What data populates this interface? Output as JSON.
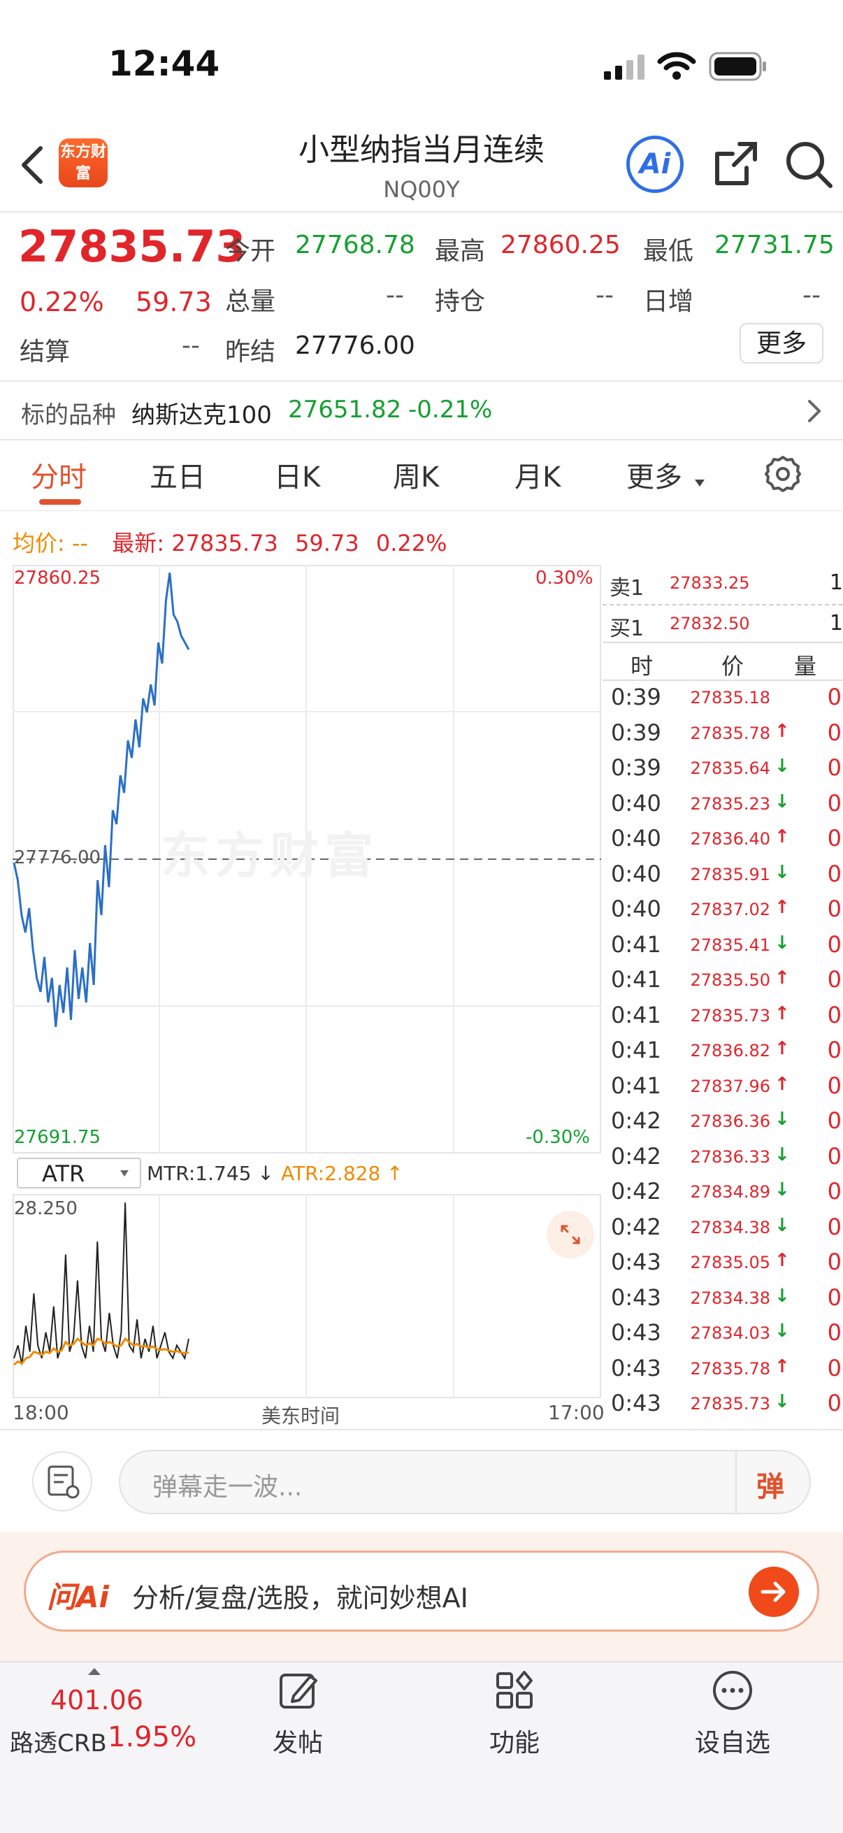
{
  "status_bar": {
    "time": "12:44"
  },
  "header": {
    "title": "小型纳指当月连续",
    "code": "NQ00Y",
    "logo_text": "东方财富",
    "ai_label": "Ai"
  },
  "quote": {
    "price": "27835.73",
    "change_pct": "0.22%",
    "change": "59.73",
    "open_label": "今开",
    "open": "27768.78",
    "high_label": "最高",
    "high": "27860.25",
    "low_label": "最低",
    "low": "27731.75",
    "volume_label": "总量",
    "volume": "--",
    "position_label": "持仓",
    "position": "--",
    "daily_inc_label": "日增",
    "daily_inc": "--",
    "settle_label": "结算",
    "settle": "--",
    "prev_settle_label": "昨结",
    "prev_settle": "27776.00",
    "more_label": "更多"
  },
  "underlying": {
    "label": "标的品种",
    "name": "纳斯达克100",
    "price": "27651.82",
    "change": "-0.21%"
  },
  "tabs": [
    "分时",
    "五日",
    "日K",
    "周K",
    "月K",
    "更多"
  ],
  "chart_info": {
    "avg_label": "均价:",
    "avg_value": "--",
    "latest_label": "最新:",
    "latest": "27835.73",
    "change": "59.73",
    "pct": "0.22%"
  },
  "chart_data": {
    "type": "line",
    "top_price": "27860.25",
    "bottom_price": "27691.75",
    "ref_price": "27776.00",
    "top_pct": "0.30%",
    "bottom_pct": "-0.30%",
    "x_start": "18:00",
    "x_mid": "美东时间",
    "x_end": "17:00",
    "watermark": "东方财富",
    "ylim": [
      27691.75,
      27860.25
    ],
    "series": [
      {
        "values": [
          27775,
          27770,
          27760,
          27755,
          27762,
          27750,
          27742,
          27738,
          27748,
          27735,
          27742,
          27728,
          27740,
          27732,
          27745,
          27730,
          27750,
          27736,
          27745,
          27735,
          27752,
          27740,
          27770,
          27760,
          27780,
          27768,
          27790,
          27786,
          27800,
          27795,
          27810,
          27805,
          27816,
          27808,
          27822,
          27818,
          27826,
          27820,
          27838,
          27832,
          27850,
          27858,
          27846,
          27844,
          27840,
          27838,
          27836
        ]
      }
    ]
  },
  "indicator": {
    "name": "ATR",
    "mtr": "MTR:1.745",
    "atr": "ATR:2.828",
    "top_value": "28.250",
    "mtr_values": [
      4,
      6,
      3,
      9,
      5,
      14,
      6,
      4,
      8,
      5,
      12,
      4,
      6,
      20,
      5,
      7,
      16,
      6,
      4,
      9,
      5,
      22,
      7,
      5,
      11,
      6,
      4,
      8,
      28,
      6,
      5,
      10,
      4,
      7,
      5,
      9,
      4,
      6,
      8,
      5,
      4,
      6,
      5,
      4,
      7
    ],
    "atr_values": [
      3,
      3.5,
      3.2,
      4,
      4.2,
      5,
      4.8,
      4.5,
      5,
      4.8,
      5.5,
      5,
      5.2,
      6.5,
      6,
      6.2,
      7,
      6.5,
      6,
      6.3,
      6,
      7,
      6.8,
      6.2,
      6.5,
      6.2,
      5.8,
      6,
      7,
      6.5,
      6,
      6.2,
      5.8,
      5.9,
      5.6,
      5.8,
      5.4,
      5.3,
      5.4,
      5.2,
      5,
      5.1,
      4.9,
      4.8,
      4.9
    ]
  },
  "order_book": {
    "ask_label": "卖1",
    "ask_price": "27833.25",
    "ask_vol": "1",
    "bid_label": "买1",
    "bid_price": "27832.50",
    "bid_vol": "1"
  },
  "ticks_header": {
    "time": "时",
    "price": "价",
    "vol": "量"
  },
  "ticks": [
    {
      "t": "0:39",
      "p": "27835.18",
      "a": "",
      "v": "0"
    },
    {
      "t": "0:39",
      "p": "27835.78",
      "a": "↑",
      "v": "0"
    },
    {
      "t": "0:39",
      "p": "27835.64",
      "a": "↓",
      "v": "0"
    },
    {
      "t": "0:40",
      "p": "27835.23",
      "a": "↓",
      "v": "0"
    },
    {
      "t": "0:40",
      "p": "27836.40",
      "a": "↑",
      "v": "0"
    },
    {
      "t": "0:40",
      "p": "27835.91",
      "a": "↓",
      "v": "0"
    },
    {
      "t": "0:40",
      "p": "27837.02",
      "a": "↑",
      "v": "0"
    },
    {
      "t": "0:41",
      "p": "27835.41",
      "a": "↓",
      "v": "0"
    },
    {
      "t": "0:41",
      "p": "27835.50",
      "a": "↑",
      "v": "0"
    },
    {
      "t": "0:41",
      "p": "27835.73",
      "a": "↑",
      "v": "0"
    },
    {
      "t": "0:41",
      "p": "27836.82",
      "a": "↑",
      "v": "0"
    },
    {
      "t": "0:41",
      "p": "27837.96",
      "a": "↑",
      "v": "0"
    },
    {
      "t": "0:42",
      "p": "27836.36",
      "a": "↓",
      "v": "0"
    },
    {
      "t": "0:42",
      "p": "27836.33",
      "a": "↓",
      "v": "0"
    },
    {
      "t": "0:42",
      "p": "27834.89",
      "a": "↓",
      "v": "0"
    },
    {
      "t": "0:42",
      "p": "27834.38",
      "a": "↓",
      "v": "0"
    },
    {
      "t": "0:43",
      "p": "27835.05",
      "a": "↑",
      "v": "0"
    },
    {
      "t": "0:43",
      "p": "27834.38",
      "a": "↓",
      "v": "0"
    },
    {
      "t": "0:43",
      "p": "27834.03",
      "a": "↓",
      "v": "0"
    },
    {
      "t": "0:43",
      "p": "27835.78",
      "a": "↑",
      "v": "0"
    },
    {
      "t": "0:43",
      "p": "27835.73",
      "a": "↓",
      "v": "0"
    }
  ],
  "comment": {
    "placeholder": "弹幕走一波...",
    "danmu_label": "弹"
  },
  "ask_ai": {
    "brand": "问Ai",
    "prompt": "分析/复盘/选股，就问妙想AI"
  },
  "bottom_nav": {
    "index_value": "401.06",
    "index_name": "路透CRB",
    "index_pct": "1.95%",
    "post_label": "发帖",
    "function_label": "功能",
    "watchlist_label": "设自选"
  },
  "colors": {
    "up": "#e0252b",
    "down": "#15a030",
    "accent": "#e0522b",
    "line": "#2b6fc7",
    "atr": "#f08a00"
  }
}
